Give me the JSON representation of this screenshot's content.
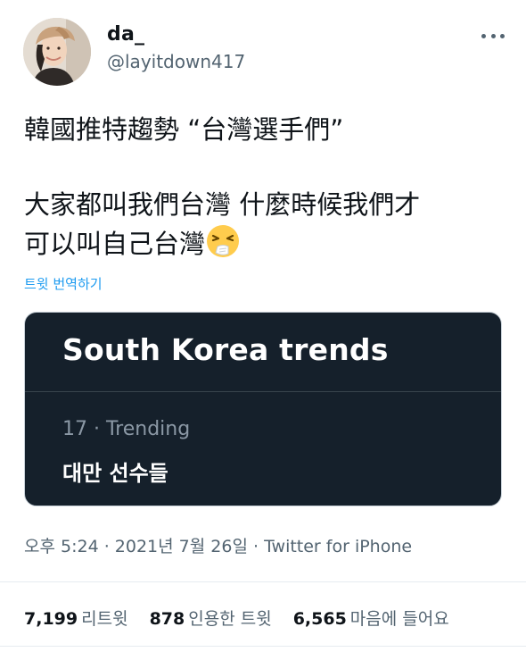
{
  "user": {
    "display_name": "da_",
    "handle": "@layitdown417"
  },
  "tweet": {
    "line1": "韓國推特趨勢 “台灣選手們”",
    "line2": "大家都叫我們台灣 什麼時候我們才",
    "line3": "可以叫自己台灣",
    "emoji": "sneezing-face-icon",
    "translate_label": "트윗 번역하기"
  },
  "card": {
    "title": "South Korea trends",
    "meta": "17 · Trending",
    "topic": "대만 선수들",
    "bg_color": "#15202b"
  },
  "timestamp": {
    "time": "오후 5:24",
    "date": "2021년 7월 26일",
    "source": "Twitter for iPhone"
  },
  "stats": [
    {
      "count": "7,199",
      "label": "리트윗"
    },
    {
      "count": "878",
      "label": "인용한 트윗"
    },
    {
      "count": "6,565",
      "label": "마음에 들어요"
    }
  ],
  "colors": {
    "link": "#1d9bf0",
    "secondary_text": "#536471"
  }
}
